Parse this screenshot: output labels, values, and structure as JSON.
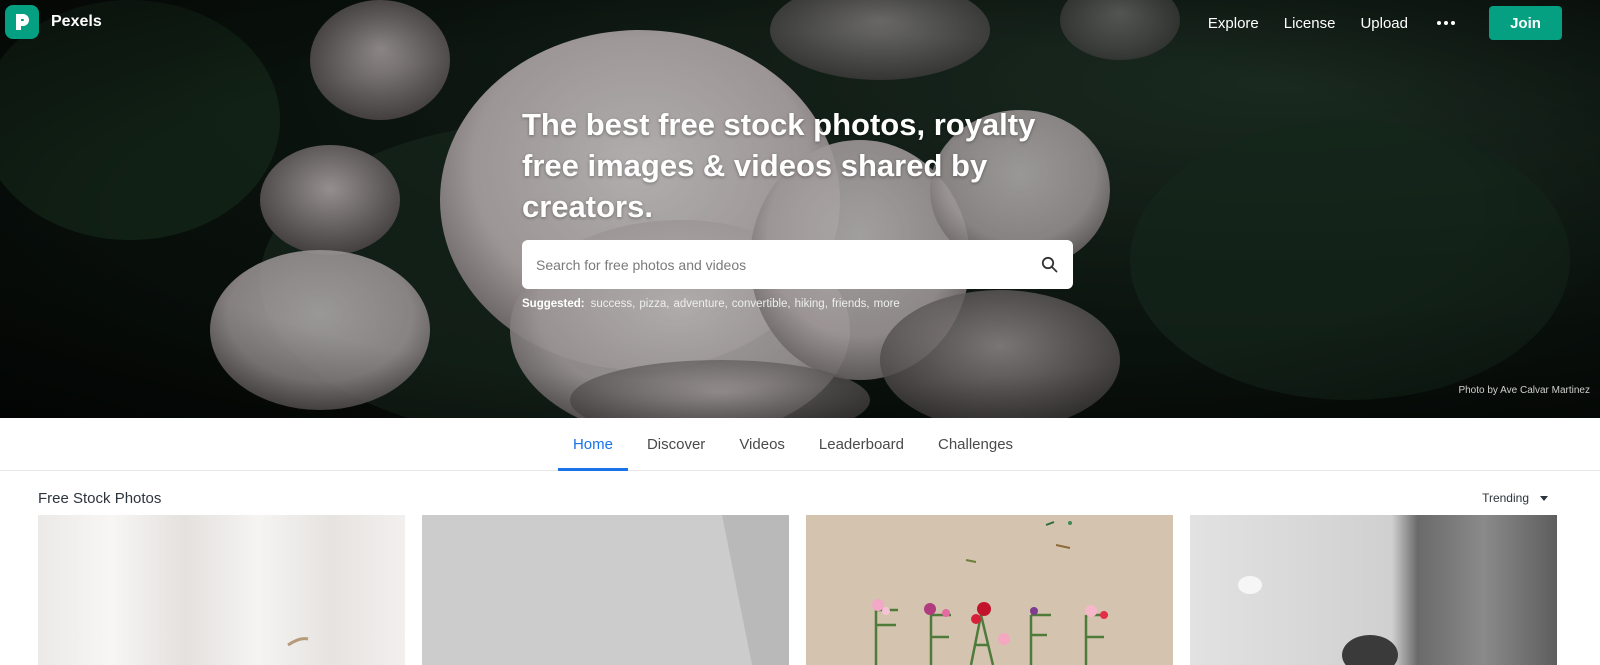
{
  "brand": {
    "name": "Pexels",
    "logo_letter": "P",
    "accent": "#05a081"
  },
  "nav": {
    "items": [
      {
        "label": "Explore"
      },
      {
        "label": "License"
      },
      {
        "label": "Upload"
      }
    ],
    "more_icon": "more-horizontal-icon",
    "join_label": "Join"
  },
  "hero": {
    "headline": "The best free stock photos, royalty free images & videos shared by creators.",
    "search": {
      "placeholder": "Search for free photos and videos",
      "value": "",
      "icon": "search-icon"
    },
    "suggested_label": "Suggested:",
    "suggestions": [
      "success",
      "pizza",
      "adventure",
      "convertible",
      "hiking",
      "friends",
      "more"
    ],
    "credit": "Photo by Ave Calvar Martinez"
  },
  "tabs": [
    {
      "label": "Home",
      "active": true
    },
    {
      "label": "Discover",
      "active": false
    },
    {
      "label": "Videos",
      "active": false
    },
    {
      "label": "Leaderboard",
      "active": false
    },
    {
      "label": "Challenges",
      "active": false
    }
  ],
  "section": {
    "title": "Free Stock Photos",
    "sort": {
      "selected": "Trending"
    }
  },
  "colors": {
    "active_tab": "#1a73e8",
    "join_button": "#05a081"
  }
}
